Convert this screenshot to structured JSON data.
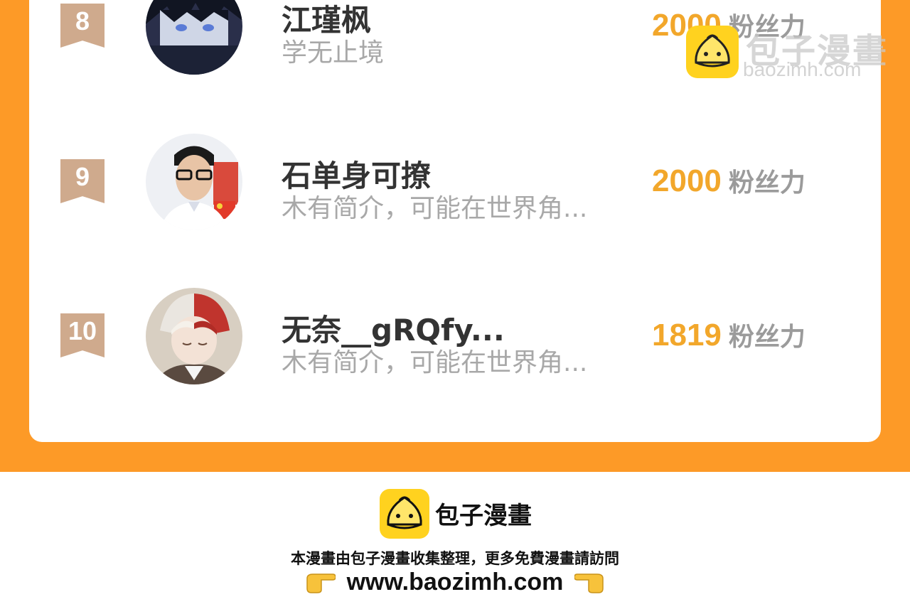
{
  "ranking": {
    "rows": [
      {
        "rank": "8",
        "name": "江瑾枫",
        "bio": "学无止境",
        "fans": "2000",
        "fans_label": "粉丝力"
      },
      {
        "rank": "9",
        "name": "石单身可撩",
        "bio": "木有简介，可能在世界角...",
        "fans": "2000",
        "fans_label": "粉丝力"
      },
      {
        "rank": "10",
        "name": "无奈__gRQfy...",
        "bio": "木有简介，可能在世界角...",
        "fans": "1819",
        "fans_label": "粉丝力"
      }
    ]
  },
  "watermark": {
    "title": "包子漫畫",
    "url": "baozimh.com"
  },
  "footer": {
    "brand": "包子漫畫",
    "note": "本漫畫由包子漫畫收集整理，更多免費漫畫請訪問",
    "url": "www.baozimh.com",
    "left_icon": "pointing-right-hand-icon",
    "right_icon": "pointing-left-hand-icon"
  },
  "colors": {
    "accent": "#FD9A27",
    "fans_number": "#F2A72B",
    "rank_ribbon": "#CFAA8D",
    "logo_yellow": "#FFD21F"
  }
}
